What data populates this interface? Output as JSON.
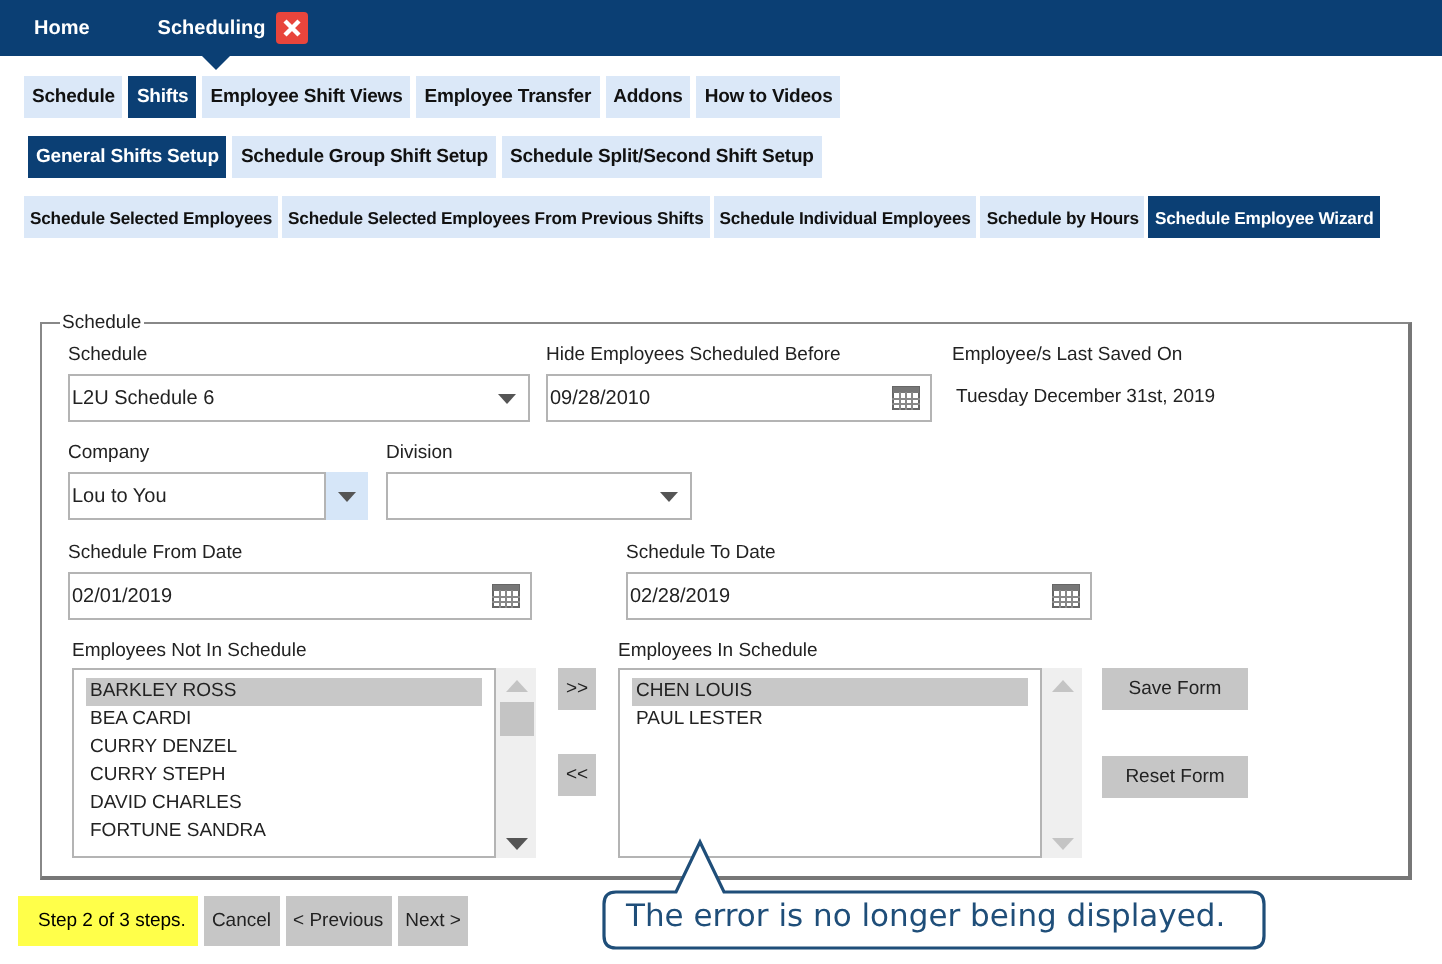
{
  "top_nav": [
    {
      "label": "Home",
      "selected": false,
      "closable": false
    },
    {
      "label": "Scheduling",
      "selected": true,
      "closable": true
    }
  ],
  "tabs": [
    {
      "label": "Schedule",
      "selected": false
    },
    {
      "label": "Shifts",
      "selected": true
    },
    {
      "label": "Employee Shift Views",
      "selected": false
    },
    {
      "label": "Employee Transfer",
      "selected": false
    },
    {
      "label": "Addons",
      "selected": false
    },
    {
      "label": "How to Videos",
      "selected": false
    }
  ],
  "subtabs": [
    {
      "label": "General Shifts Setup",
      "selected": true
    },
    {
      "label": "Schedule Group Shift Setup",
      "selected": false
    },
    {
      "label": "Schedule Split/Second Shift Setup",
      "selected": false
    }
  ],
  "wizard_tabs": [
    {
      "label": "Schedule Selected Employees",
      "selected": false
    },
    {
      "label": "Schedule Selected Employees From Previous Shifts",
      "selected": false
    },
    {
      "label": "Schedule Individual Employees",
      "selected": false
    },
    {
      "label": "Schedule by Hours",
      "selected": false
    },
    {
      "label": "Schedule Employee Wizard",
      "selected": true
    }
  ],
  "form": {
    "legend": "Schedule",
    "schedule": {
      "label": "Schedule",
      "value": "L2U Schedule 6"
    },
    "hide_before": {
      "label": "Hide Employees Scheduled Before",
      "value": "09/28/2010"
    },
    "last_saved": {
      "label": "Employee/s Last Saved On",
      "value": "Tuesday December 31st, 2019"
    },
    "company": {
      "label": "Company",
      "value": "Lou to You",
      "arrow_highlighted": true
    },
    "division": {
      "label": "Division",
      "arrow_highlighted": false
    },
    "from_date": {
      "label": "Schedule From Date",
      "value": "02/01/2019"
    },
    "to_date": {
      "label": "Schedule To Date",
      "value": "02/28/2019"
    },
    "not_in_schedule": {
      "label": "Employees Not In Schedule",
      "items": [
        {
          "name": "BARKLEY ROSS",
          "selected": true
        },
        {
          "name": "BEA CARDI",
          "selected": false
        },
        {
          "name": "CURRY DENZEL",
          "selected": false
        },
        {
          "name": "CURRY STEPH",
          "selected": false
        },
        {
          "name": "DAVID CHARLES",
          "selected": false
        },
        {
          "name": "FORTUNE SANDRA",
          "selected": false
        }
      ]
    },
    "move_buttons": [
      ">>",
      "<<"
    ],
    "in_schedule": {
      "label": "Employees In Schedule",
      "items": [
        {
          "name": "CHEN LOUIS",
          "selected": true
        },
        {
          "name": "PAUL LESTER",
          "selected": false
        }
      ]
    },
    "form_buttons": [
      "Save Form",
      "Reset Form"
    ]
  },
  "footer": {
    "step": "Step 2 of 3 steps.",
    "buttons": [
      "Cancel",
      "< Previous",
      "Next >"
    ]
  },
  "callout": "The error is no longer being displayed."
}
